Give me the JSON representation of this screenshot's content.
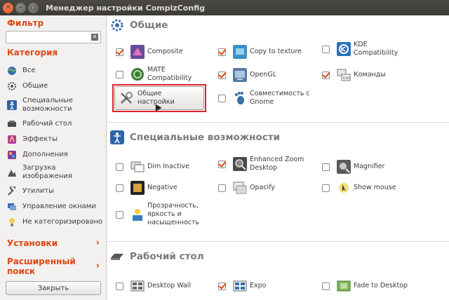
{
  "window": {
    "title": "Менеджер настройки CompizConfig"
  },
  "sidebar": {
    "filter_heading": "Фильтр",
    "filter_value": "",
    "category_heading": "Категория",
    "categories": [
      {
        "label": "Все",
        "icon": "globe-icon"
      },
      {
        "label": "Общие",
        "icon": "gear-icon"
      },
      {
        "label": "Специальные возможности",
        "icon": "accessibility-icon"
      },
      {
        "label": "Рабочий стол",
        "icon": "desktop-icon"
      },
      {
        "label": "Эффекты",
        "icon": "effects-icon"
      },
      {
        "label": "Дополнения",
        "icon": "extras-icon"
      },
      {
        "label": "Загрузка изображения",
        "icon": "image-loading-icon"
      },
      {
        "label": "Утилиты",
        "icon": "utilities-icon"
      },
      {
        "label": "Управление окнами",
        "icon": "window-management-icon"
      },
      {
        "label": "Не категоризировано",
        "icon": "uncategorized-icon"
      }
    ],
    "settings_link": "Установки",
    "advanced_search_link": "Расширенный поиск",
    "close_button": "Закрыть"
  },
  "sections": [
    {
      "title": "Общие",
      "general_settings_button": "Общие настройки",
      "plugins": [
        {
          "label": "Composite",
          "checked": true
        },
        {
          "label": "Copy to texture",
          "checked": true
        },
        {
          "label": "KDE Compatibility",
          "checked": false
        },
        {
          "label": "MATE Compatibility",
          "checked": false
        },
        {
          "label": "OpenGL",
          "checked": true
        },
        {
          "label": "Команды",
          "checked": true
        },
        {
          "label": "Совместимость с Gnome",
          "checked": false
        }
      ]
    },
    {
      "title": "Специальные возможности",
      "plugins": [
        {
          "label": "Dim Inactive",
          "checked": false
        },
        {
          "label": "Enhanced Zoom Desktop",
          "checked": true
        },
        {
          "label": "Magnifier",
          "checked": false
        },
        {
          "label": "Negative",
          "checked": false
        },
        {
          "label": "Opacify",
          "checked": false
        },
        {
          "label": "Show mouse",
          "checked": false
        },
        {
          "label": "Прозрачность, яркость и насыщенность",
          "checked": false
        }
      ]
    },
    {
      "title": "Рабочий стол",
      "plugins": [
        {
          "label": "Desktop Wall",
          "checked": false
        },
        {
          "label": "Expo",
          "checked": true
        },
        {
          "label": "Fade to Desktop",
          "checked": false
        }
      ]
    }
  ],
  "colors": {
    "accent": "#dd4814",
    "highlight": "#e0222e",
    "titlebar": "#3c3b37"
  }
}
